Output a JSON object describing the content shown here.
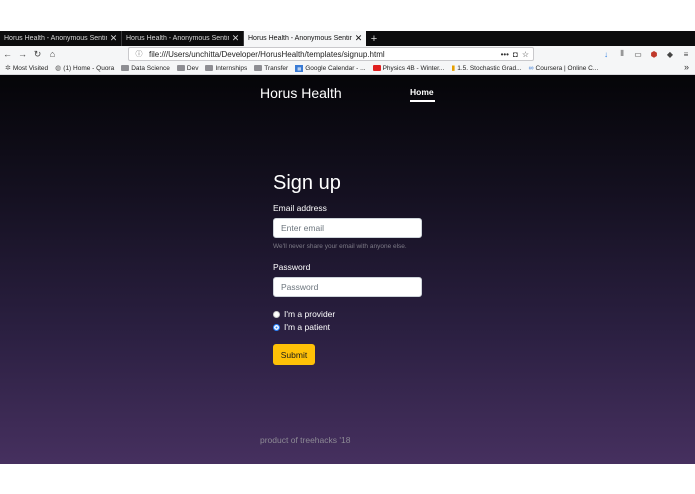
{
  "browser": {
    "tabs": [
      {
        "title": "Horus Health - Anonymous Sentime"
      },
      {
        "title": "Horus Health - Anonymous Sentime"
      },
      {
        "title": "Horus Health - Anonymous Sentime"
      }
    ],
    "new_tab_glyph": "+",
    "url": "file:///Users/unchitta/Developer/HorusHealth/templates/signup.html",
    "bookmarks": [
      {
        "label": "Most Visited",
        "icon": "gear-icon"
      },
      {
        "label": "(1) Home - Quora",
        "icon": "globe-icon"
      },
      {
        "label": "Data Science",
        "icon": "folder-icon"
      },
      {
        "label": "Dev",
        "icon": "folder-icon"
      },
      {
        "label": "Internships",
        "icon": "folder-icon"
      },
      {
        "label": "Transfer",
        "icon": "folder-icon"
      },
      {
        "label": "Google Calendar - ...",
        "icon": "calendar-icon"
      },
      {
        "label": "Physics 4B - Winter...",
        "icon": "youtube-icon"
      },
      {
        "label": "1.5. Stochastic Grad...",
        "icon": "bars-icon"
      },
      {
        "label": "Coursera | Online C...",
        "icon": "coursera-icon"
      }
    ],
    "more_glyph": "»"
  },
  "site": {
    "brand": "Horus Health",
    "nav_home": "Home"
  },
  "signup": {
    "title": "Sign up",
    "email_label": "Email address",
    "email_placeholder": "Enter email",
    "email_help": "We'll never share your email with anyone else.",
    "password_label": "Password",
    "password_placeholder": "Password",
    "radio_provider": "I'm a provider",
    "radio_patient": "I'm a patient",
    "submit": "Submit",
    "selected_role": "patient"
  },
  "footer": {
    "text": "product of treehacks '18"
  },
  "colors": {
    "submit_bg": "#ffc107",
    "radio_checked": "#2e86ff"
  }
}
